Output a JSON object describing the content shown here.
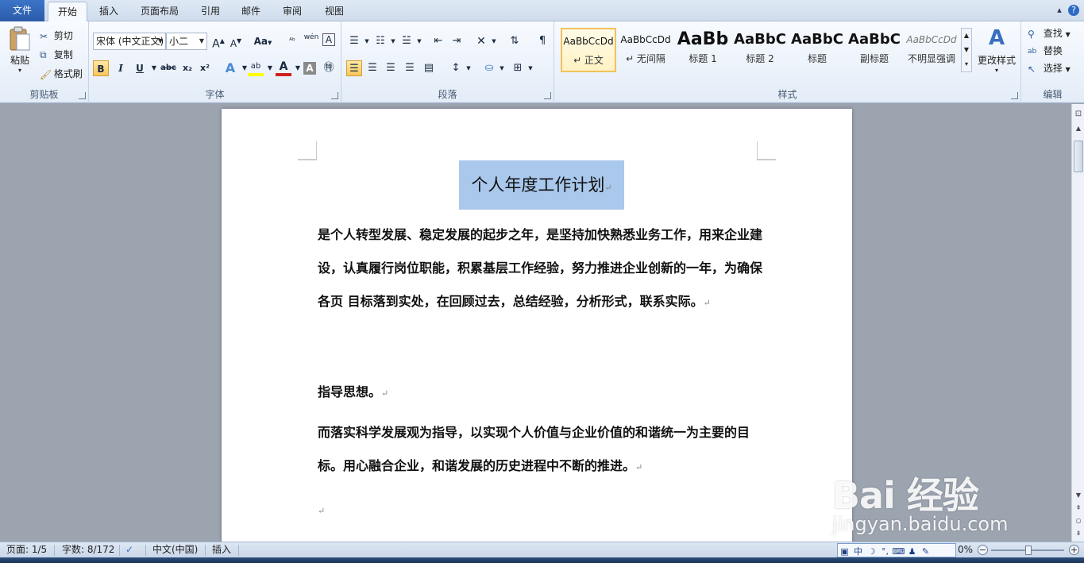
{
  "tabs": [
    {
      "label": "文件"
    },
    {
      "label": "开始"
    },
    {
      "label": "插入"
    },
    {
      "label": "页面布局"
    },
    {
      "label": "引用"
    },
    {
      "label": "邮件"
    },
    {
      "label": "审阅"
    },
    {
      "label": "视图"
    }
  ],
  "clipboard": {
    "paste": "粘贴",
    "cut": "剪切",
    "copy": "复制",
    "format_painter": "格式刷",
    "group_label": "剪贴板"
  },
  "font": {
    "name": "宋体 (中文正文)",
    "size": "小二",
    "grow": "A",
    "shrink": "A",
    "case": "Aa",
    "phonetic": "wén",
    "bold": "B",
    "italic": "I",
    "underline": "U",
    "strike": "abc",
    "subscript": "x₂",
    "superscript": "x²",
    "group_label": "字体"
  },
  "paragraph": {
    "group_label": "段落"
  },
  "styles": {
    "items": [
      {
        "sample": "AaBbCcDd",
        "label": "↵ 正文"
      },
      {
        "sample": "AaBbCcDd",
        "label": "↵ 无间隔"
      },
      {
        "sample": "AaBb",
        "label": "标题 1"
      },
      {
        "sample": "AaBbC",
        "label": "标题 2"
      },
      {
        "sample": "AaBbC",
        "label": "标题"
      },
      {
        "sample": "AaBbC",
        "label": "副标题"
      },
      {
        "sample": "AaBbCcDd",
        "label": "不明显强调"
      }
    ],
    "change_styles": "更改样式",
    "group_label": "样式"
  },
  "editing": {
    "find": "查找",
    "replace": "替换",
    "select": "选择",
    "group_label": "编辑"
  },
  "document": {
    "title": "个人年度工作计划",
    "para1": "是个人转型发展、稳定发展的起步之年，是坚持加快熟悉业务工作，用来企业建设，认真履行岗位职能，积累基层工作经验，努力推进企业创新的一年，为确保各页 目标落到实处，在回顾过去，总结经验，分析形式，联系实际。",
    "heading2": "指导思想。",
    "para2": "而落实科学发展观为指导，以实现个人价值与企业价值的和谐统一为主要的目标。用心融合企业，和谐发展的历史进程中不断的推进。",
    "para_mark": "↵"
  },
  "status": {
    "page": "页面: 1/5",
    "words": "字数: 8/172",
    "language": "中文(中国)",
    "mode": "插入",
    "zoom": "0%",
    "ime_mode": "中"
  },
  "watermark": {
    "brand": "Bai 经验",
    "url": "jingyan.baidu.com"
  },
  "colors": {
    "highlight": "#a9c8ec",
    "file_tab": "#2a5ba8",
    "font_color": "#d02020",
    "highlight_color": "#ffff00"
  }
}
